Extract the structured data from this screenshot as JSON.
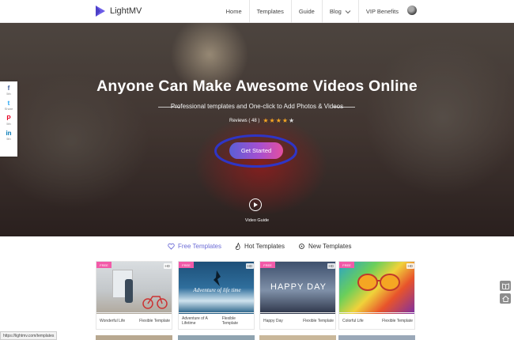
{
  "brand": {
    "name": "LightMV",
    "accent": "#6c5ce7"
  },
  "nav": {
    "home": "Home",
    "templates": "Templates",
    "guide": "Guide",
    "blog": "Blog",
    "vip": "VIP Benefits"
  },
  "hero": {
    "title": "Anyone Can Make Awesome Videos Online",
    "subtitle": "Professional templates and One-click to Add Photos & Videos",
    "reviews": "Reviews ( 48 )",
    "rating_stars": 4,
    "cta": "Get Started",
    "video_guide": "Video Guide"
  },
  "share": [
    {
      "glyph": "f",
      "count": "5th",
      "icon": "facebook-icon",
      "color": "#3b5998"
    },
    {
      "glyph": "t",
      "count": "Share",
      "icon": "twitter-icon",
      "color": "#1da1f2"
    },
    {
      "glyph": "P",
      "count": "5th",
      "icon": "pinterest-icon",
      "color": "#e60023"
    },
    {
      "glyph": "in",
      "count": "5th",
      "icon": "linkedin-icon",
      "color": "#0077b5"
    }
  ],
  "tabs": {
    "free": "Free Templates",
    "hot": "Hot Templates",
    "new": "New Templates"
  },
  "cards": [
    {
      "name": "Wonderful Life",
      "kind": "Flexible Template",
      "badge": "FREE",
      "quality": "HD",
      "overlay": ""
    },
    {
      "name": "Adventure of A Lifetime",
      "kind": "Flexible Template",
      "badge": "FREE",
      "quality": "HD",
      "overlay": "Adventure of life time"
    },
    {
      "name": "Happy Day",
      "kind": "Flexible Template",
      "badge": "FREE",
      "quality": "HD",
      "overlay": "HAPPY DAY"
    },
    {
      "name": "Colorful Life",
      "kind": "Flexible Template",
      "badge": "FREE",
      "quality": "HD",
      "overlay": ""
    }
  ],
  "status_url": "https://lightmv.com/templates"
}
